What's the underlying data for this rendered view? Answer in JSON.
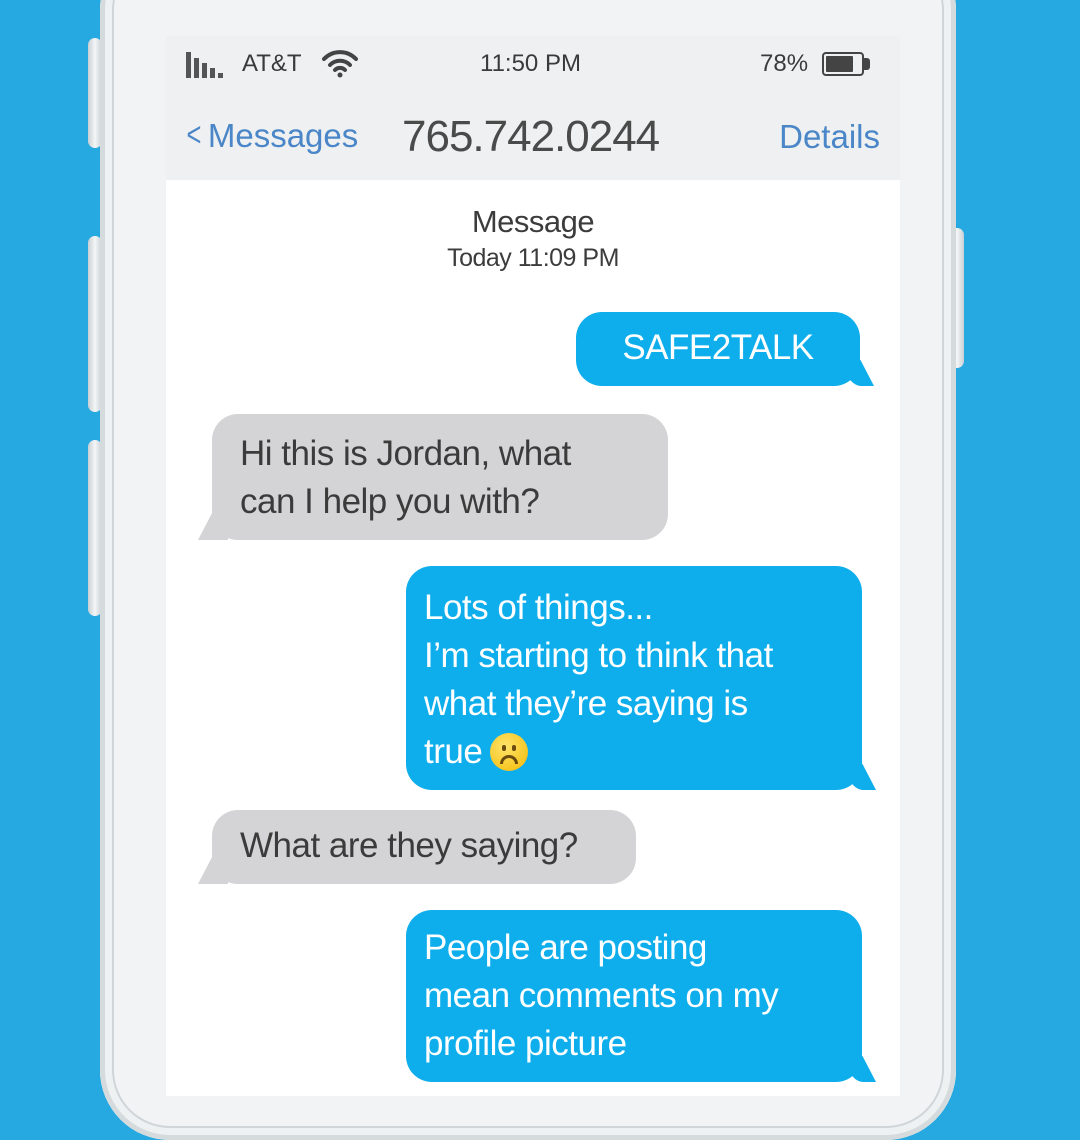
{
  "status_bar": {
    "carrier": "AT&T",
    "time": "11:50 PM",
    "battery_percent": "78%",
    "battery_level": 0.78,
    "icons": [
      "signal-bars-icon",
      "wifi-icon",
      "battery-icon"
    ]
  },
  "nav": {
    "back_label": "Messages",
    "title": "765.742.0244",
    "details_label": "Details"
  },
  "thread_header": {
    "title": "Message",
    "timestamp": "Today 11:09 PM"
  },
  "messages": [
    {
      "direction": "outgoing",
      "lines": [
        "SAFE2TALK"
      ]
    },
    {
      "direction": "incoming",
      "lines": [
        "Hi this is Jordan, what",
        "can I help you with?"
      ]
    },
    {
      "direction": "outgoing",
      "lines": [
        "Lots of things...",
        "I’m starting to think that",
        "what they’re saying is",
        "true"
      ],
      "emoji": "sad-face-emoji"
    },
    {
      "direction": "incoming",
      "lines": [
        "What are they saying?"
      ]
    },
    {
      "direction": "outgoing",
      "lines": [
        "People are posting",
        "mean comments on my",
        "profile picture"
      ]
    }
  ],
  "colors": {
    "background": "#26a8e1",
    "outgoing_bubble": "#0eaeec",
    "incoming_bubble": "#d4d4d6",
    "link": "#4a86c8"
  }
}
